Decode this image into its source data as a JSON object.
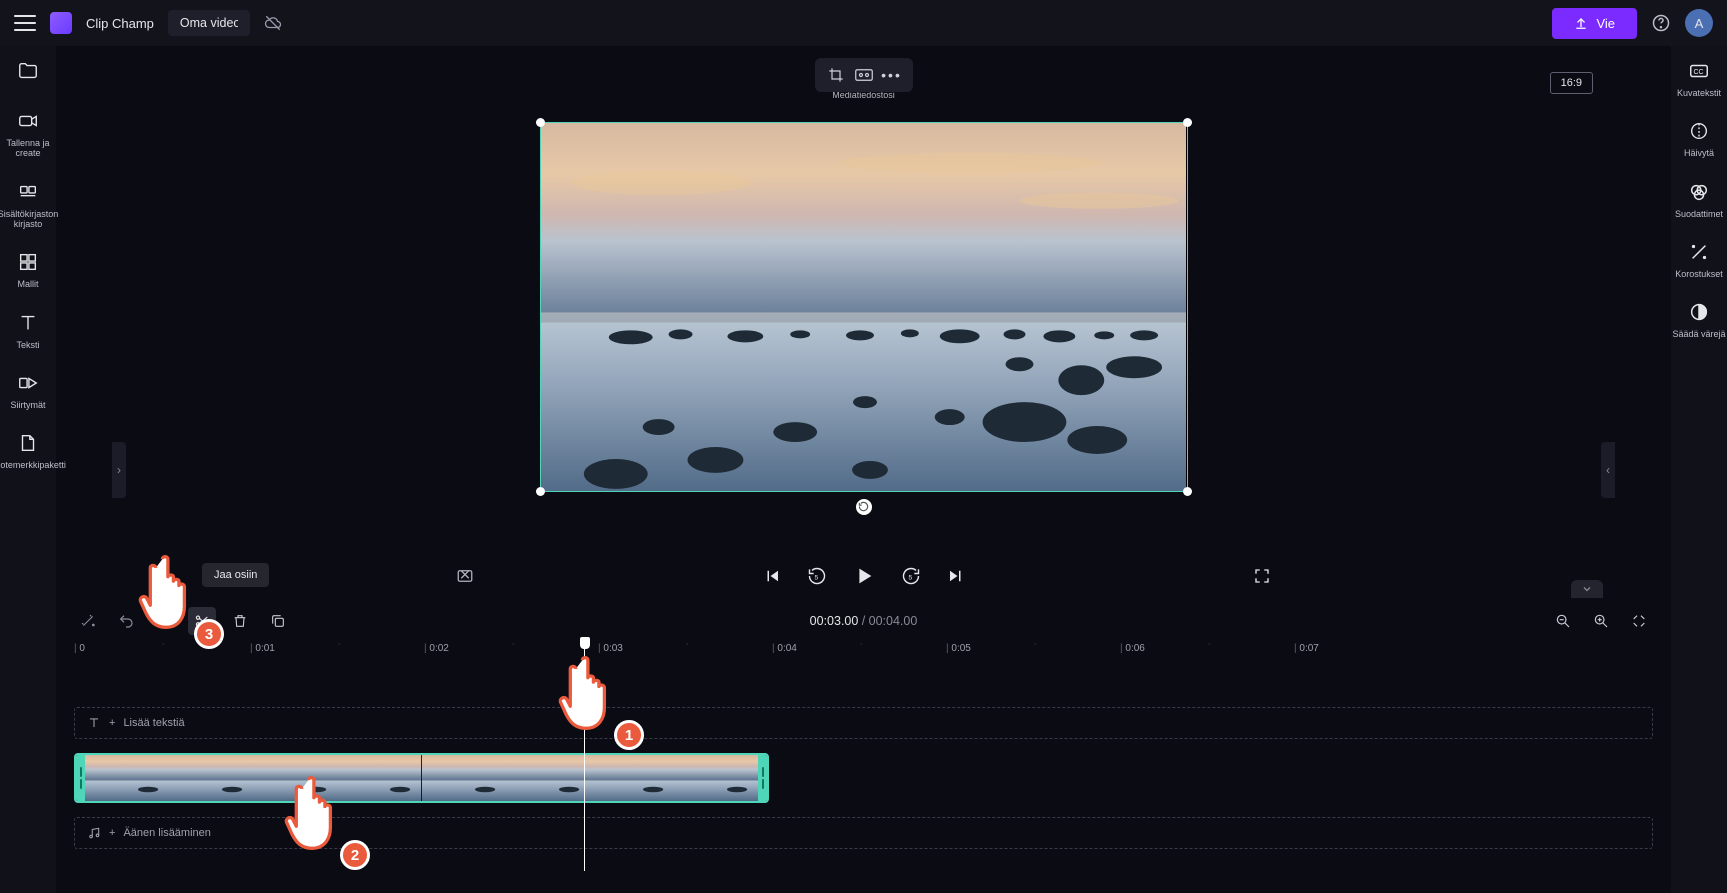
{
  "app": {
    "name": "Clip Champ",
    "project": "Oma video",
    "export_label": "Vie",
    "avatar": "A",
    "aspect": "16:9",
    "mediatiedostosi": "Mediatiedostosi"
  },
  "tooltip": {
    "split": "Jaa osiin"
  },
  "left_sidebar": [
    {
      "id": "media",
      "icon": "folder",
      "label": ""
    },
    {
      "id": "record",
      "icon": "camera",
      "label": "Tallenna ja create"
    },
    {
      "id": "library",
      "icon": "library",
      "label": "Sisältökirjaston kirjasto"
    },
    {
      "id": "templates",
      "icon": "grid",
      "label": "Mallit"
    },
    {
      "id": "text",
      "icon": "text",
      "label": "Teksti"
    },
    {
      "id": "transitions",
      "icon": "transition",
      "label": "Siirtymät"
    },
    {
      "id": "brand",
      "icon": "brand",
      "label": "Tuotemerkkipaketti"
    }
  ],
  "right_sidebar": [
    {
      "id": "captions",
      "icon": "cc",
      "label": "Kuvatekstit"
    },
    {
      "id": "fade",
      "icon": "fade",
      "label": "Häivytä"
    },
    {
      "id": "filters",
      "icon": "filters",
      "label": "Suodattimet"
    },
    {
      "id": "effects",
      "icon": "effects",
      "label": "Korostukset"
    },
    {
      "id": "colors",
      "icon": "contrast",
      "label": "Säädä värejä"
    }
  ],
  "playback": {
    "current": "00:03.00",
    "duration": "00:04.00"
  },
  "ruler": [
    "0",
    "0:01",
    "0:02",
    "0:03",
    "0:04",
    "0:05",
    "0:06",
    "0:07"
  ],
  "tracks": {
    "text_prompt": "Lisää tekstiä",
    "audio_prompt": "Äänen lisääminen"
  },
  "pointers": {
    "1": "1",
    "2": "2",
    "3": "3"
  }
}
